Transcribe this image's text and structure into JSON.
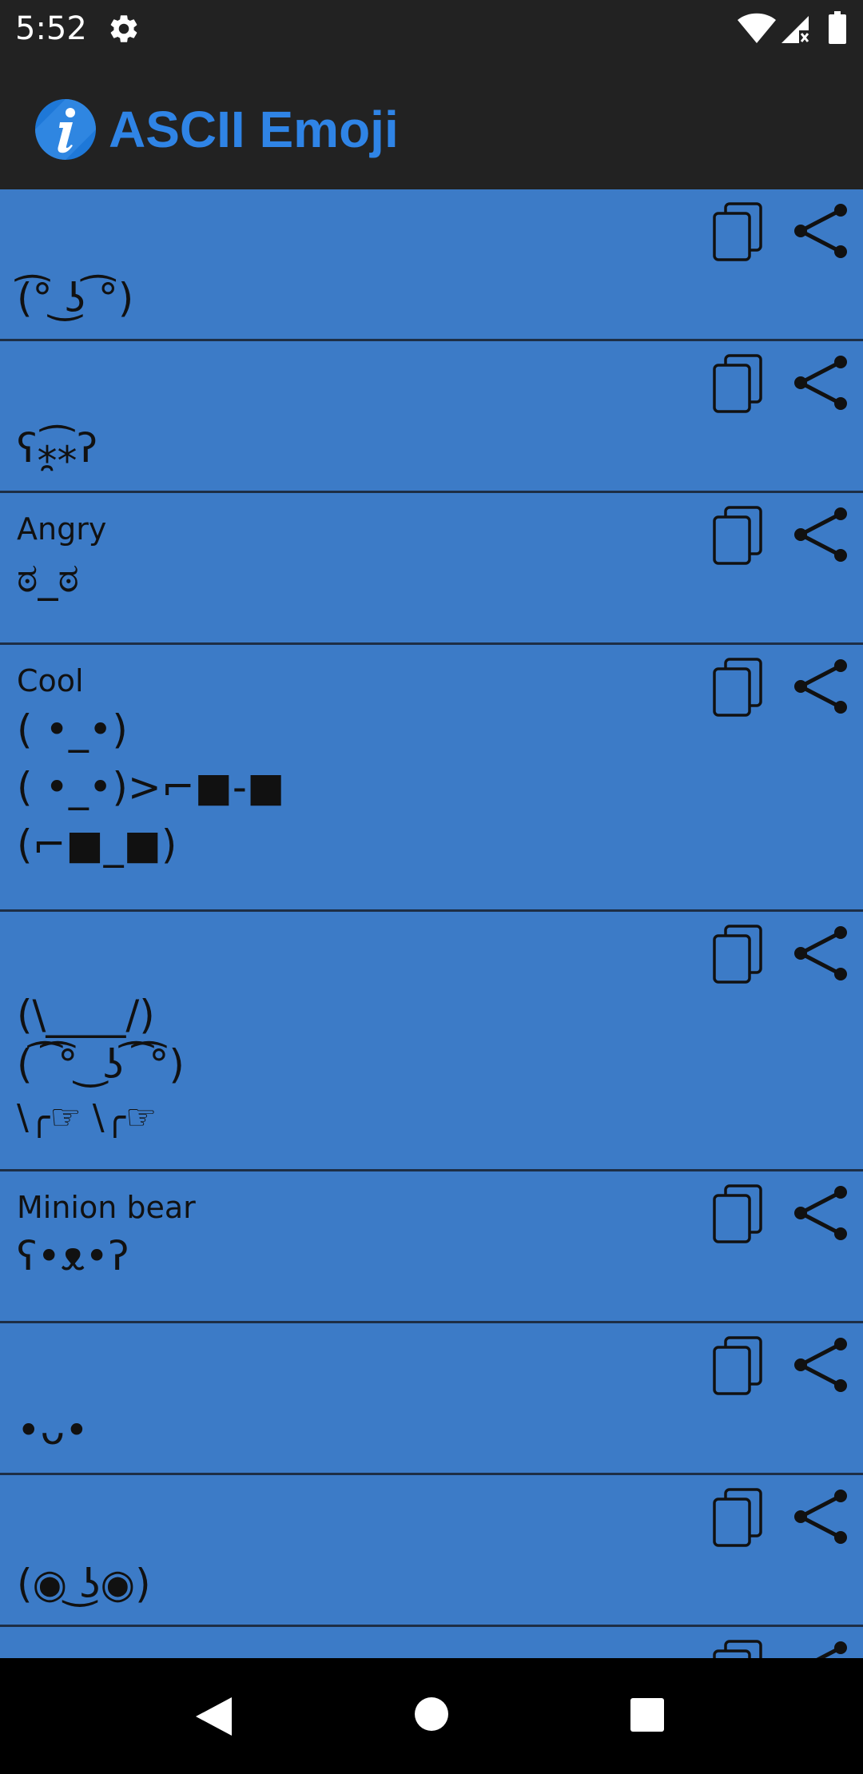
{
  "status_bar": {
    "time": "5:52",
    "icons": [
      "settings-gear-icon",
      "wifi-icon",
      "cell-signal-icon",
      "battery-icon"
    ]
  },
  "app_bar": {
    "title": "ASCII Emoji",
    "logo_icon": "info-icon",
    "title_color": "#2f84e6"
  },
  "colors": {
    "card_background": "#3c7bc7",
    "divider": "#1d2e45",
    "text": "#111111",
    "bar_background": "#222222"
  },
  "cards": [
    {
      "title": "",
      "lines": [
        "(͡° ͜ʖ ͡°)"
      ]
    },
    {
      "title": "",
      "lines": [
        "ʕ⁎̯͡⁎ʔ"
      ]
    },
    {
      "title": "Angry",
      "lines": [
        "ಠ_ಠ"
      ]
    },
    {
      "title": "Cool",
      "lines": [
        "( •_•)",
        "( •_•)>⌐■-■",
        "(⌐■_■)"
      ]
    },
    {
      "title": "",
      "lines": [
        "(\\____/)",
        "( ͡ ͡° ͜ ʖ ͡ ͡°)",
        "\\╭☞ \\╭☞"
      ]
    },
    {
      "title": "Minion bear",
      "lines": [
        "ʕ•ᴥ•ʔ"
      ]
    },
    {
      "title": "",
      "lines": [
        "•ᴗ•"
      ]
    },
    {
      "title": "",
      "lines": [
        "(◉ ͜ʖ◉)"
      ]
    },
    {
      "title": "",
      "lines": [
        ""
      ]
    }
  ],
  "card_actions": {
    "copy_icon": "copy-icon",
    "share_icon": "share-icon"
  },
  "nav_bar": {
    "icons": [
      "back-icon",
      "home-icon",
      "recents-icon"
    ]
  }
}
